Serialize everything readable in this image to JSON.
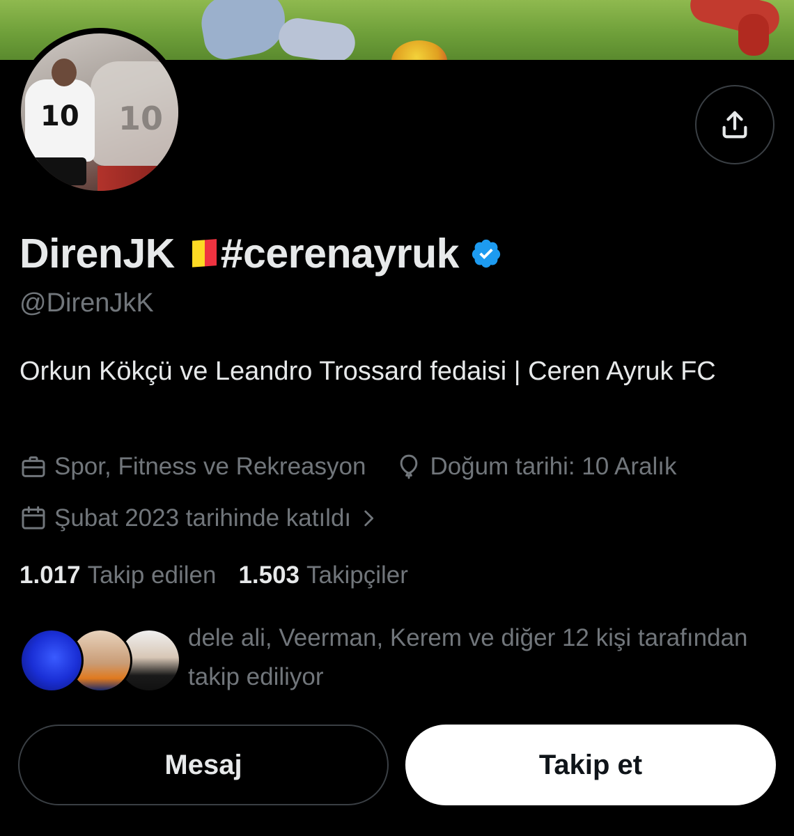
{
  "profile": {
    "display_name_prefix": "DirenJK",
    "display_name_suffix": "#cerenayruk",
    "flag_colors": [
      "#000000",
      "#FDDA24",
      "#EF3340"
    ],
    "verified_color": "#1d9bf0",
    "handle": "@DirenJkK",
    "bio": "Orkun Kökçü ve Leandro Trossard fedaisi | Ceren Ayruk FC",
    "category": "Spor, Fitness ve Rekreasyon",
    "birthday": "Doğum tarihi: 10 Aralık",
    "joined": "Şubat 2023 tarihinde katıldı",
    "following_count": "1.017",
    "following_label": "Takip edilen",
    "followers_count": "1.503",
    "followers_label": "Takipçiler"
  },
  "mutuals": {
    "text": "dele ali, Veerman, Kerem ve diğer 12 kişi tarafından takip ediliyor"
  },
  "actions": {
    "message_label": "Mesaj",
    "follow_label": "Takip et"
  },
  "icons": {
    "share": "share-icon",
    "category": "briefcase-icon",
    "birthday": "balloon-icon",
    "joined": "calendar-icon",
    "joined_more": "chevron-right-icon",
    "verified": "verified-badge-icon"
  },
  "colors": {
    "background": "#000000",
    "primary_text": "#e7e9ea",
    "secondary_text": "#71767b",
    "border": "#3a3f44",
    "follow_button_bg": "#ffffff"
  }
}
